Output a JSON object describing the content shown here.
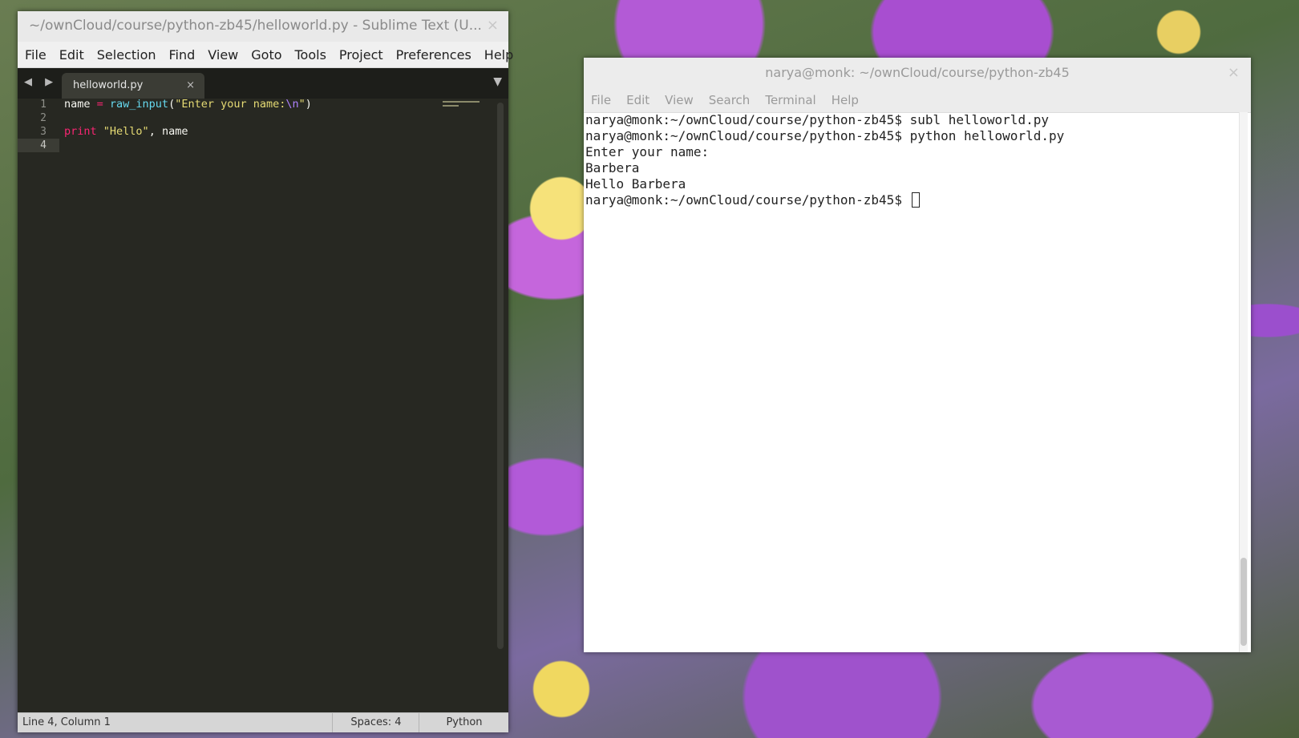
{
  "sublime": {
    "title": "~/ownCloud/course/python-zb45/helloworld.py - Sublime Text (U...",
    "close_glyph": "×",
    "menu": [
      "File",
      "Edit",
      "Selection",
      "Find",
      "View",
      "Goto",
      "Tools",
      "Project",
      "Preferences",
      "Help"
    ],
    "nav_arrows": "◀ ▶",
    "tab": {
      "label": "helloworld.py",
      "close_glyph": "×"
    },
    "dropdown_glyph": "▼",
    "line_numbers": [
      "1",
      "2",
      "3",
      "4"
    ],
    "code": {
      "line1": {
        "var": "name",
        "op": " = ",
        "fn": "raw_input",
        "open": "(",
        "str1": "\"Enter your name:",
        "esc": "\\n",
        "str2": "\"",
        "close": ")"
      },
      "line3": {
        "kw": "print",
        "sp": " ",
        "str": "\"Hello\"",
        "rest": ", name"
      }
    },
    "status": {
      "position": "Line 4, Column 1",
      "spaces": "Spaces: 4",
      "syntax": "Python"
    }
  },
  "terminal": {
    "title": "narya@monk: ~/ownCloud/course/python-zb45",
    "close_glyph": "×",
    "menu": [
      "File",
      "Edit",
      "View",
      "Search",
      "Terminal",
      "Help"
    ],
    "lines": [
      "narya@monk:~/ownCloud/course/python-zb45$ subl helloworld.py",
      "narya@monk:~/ownCloud/course/python-zb45$ python helloworld.py",
      "Enter your name:",
      "Barbera",
      "Hello Barbera",
      "narya@monk:~/ownCloud/course/python-zb45$ "
    ]
  }
}
